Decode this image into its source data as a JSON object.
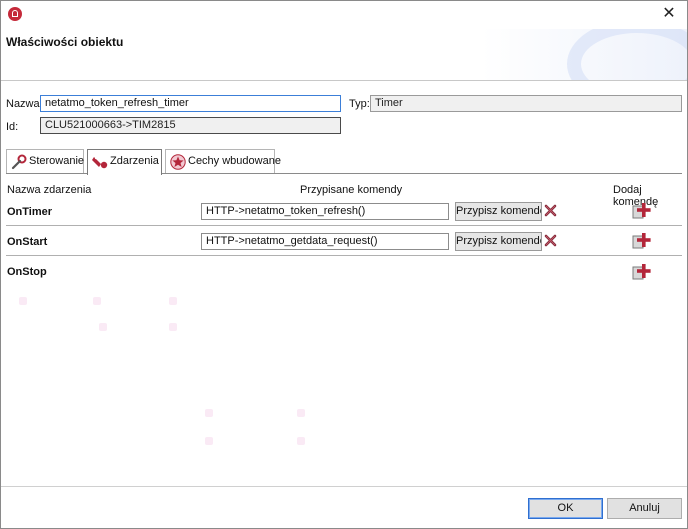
{
  "window": {
    "title_icon": "app-house-icon",
    "close_glyph": "✕"
  },
  "banner": {
    "title": "Właściwości obiektu"
  },
  "properties": {
    "name_label": "Nazwa:",
    "name_value": "netatmo_token_refresh_timer",
    "type_label": "Typ:",
    "type_value": "Timer",
    "id_label": "Id:",
    "id_value": "CLU521000663->TIM2815"
  },
  "tabs": [
    {
      "label": "Sterowanie",
      "icon": "steering-wrench-icon",
      "selected": false
    },
    {
      "label": "Zdarzenia",
      "icon": "events-icon",
      "selected": true
    },
    {
      "label": "Cechy wbudowane",
      "icon": "builtin-features-icon",
      "selected": false
    }
  ],
  "events": {
    "header_name": "Nazwa zdarzenia",
    "header_commands": "Przypisane komendy",
    "header_add": "Dodaj komendę",
    "assign_label": "Przypisz komendę",
    "rows": [
      {
        "name": "OnTimer",
        "command": "HTTP->netatmo_token_refresh()"
      },
      {
        "name": "OnStart",
        "command": "HTTP->netatmo_getdata_request()"
      },
      {
        "name": "OnStop",
        "command": ""
      }
    ]
  },
  "footer": {
    "ok_label": "OK",
    "cancel_label": "Anuluj"
  },
  "colors": {
    "accent_red": "#b3263a",
    "focus_blue": "#3c7fd8"
  }
}
